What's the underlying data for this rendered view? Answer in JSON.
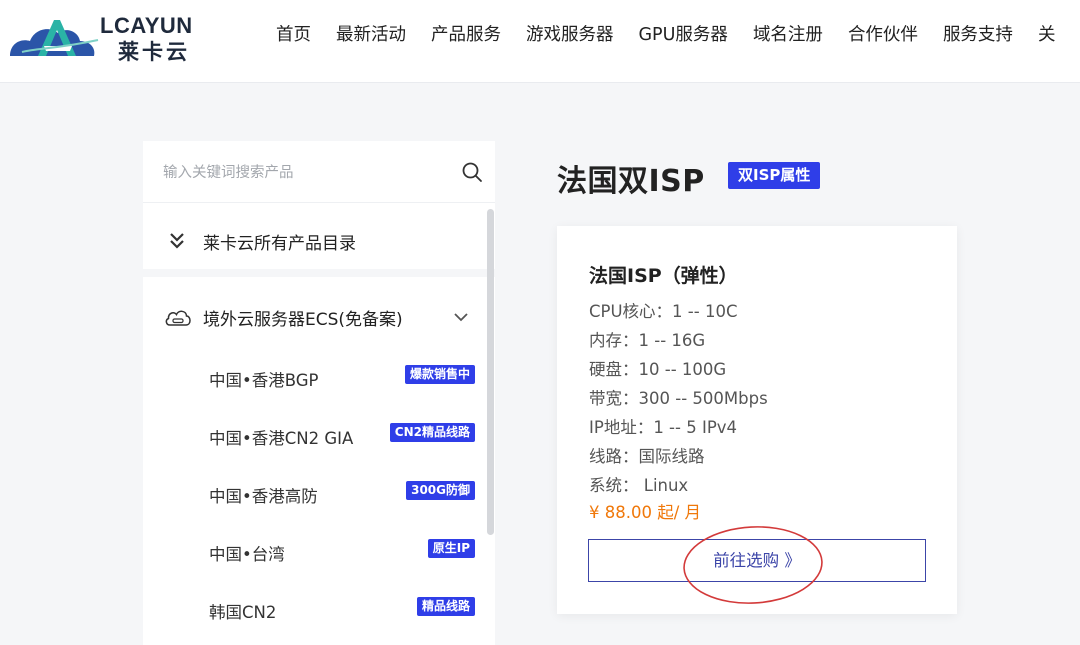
{
  "brand": {
    "name": "LCAYUN",
    "sub": "莱卡云"
  },
  "nav": [
    "首页",
    "最新活动",
    "产品服务",
    "游戏服务器",
    "GPU服务器",
    "域名注册",
    "合作伙伴",
    "服务支持",
    "关"
  ],
  "sidebar": {
    "search_placeholder": "输入关键词搜索产品",
    "catalog_label": "莱卡云所有产品目录",
    "group_label": "境外云服务器ECS(免备案)",
    "items": [
      {
        "label": "中国•香港BGP",
        "badge": "爆款销售中"
      },
      {
        "label": "中国•香港CN2 GIA",
        "badge": "CN2精品线路"
      },
      {
        "label": "中国•香港高防",
        "badge": "300G防御"
      },
      {
        "label": "中国•台湾",
        "badge": "原生IP"
      },
      {
        "label": "韩国CN2",
        "badge": "精品线路"
      }
    ]
  },
  "main": {
    "title": "法国双ISP",
    "title_badge": "双ISP属性",
    "card": {
      "title": "法国ISP（弹性）",
      "specs": [
        "CPU核心：1 -- 10C",
        "内存：1 -- 16G",
        "硬盘：10 -- 100G",
        "带宽：300 -- 500Mbps",
        "IP地址：1 -- 5 IPv4",
        "线路：国际线路",
        "系统： Linux"
      ],
      "price": "¥ 88.00 起/ 月",
      "buy_label": "前往选购 》"
    }
  },
  "colors": {
    "accent": "#2f3ee8",
    "price": "#f0780a",
    "button_border": "#3c45a8",
    "annotation": "#d33a3a"
  },
  "icons": [
    "lcayun-logo-icon",
    "search-icon",
    "double-chevron-down-icon",
    "cloud-icon",
    "chevron-down-icon"
  ]
}
